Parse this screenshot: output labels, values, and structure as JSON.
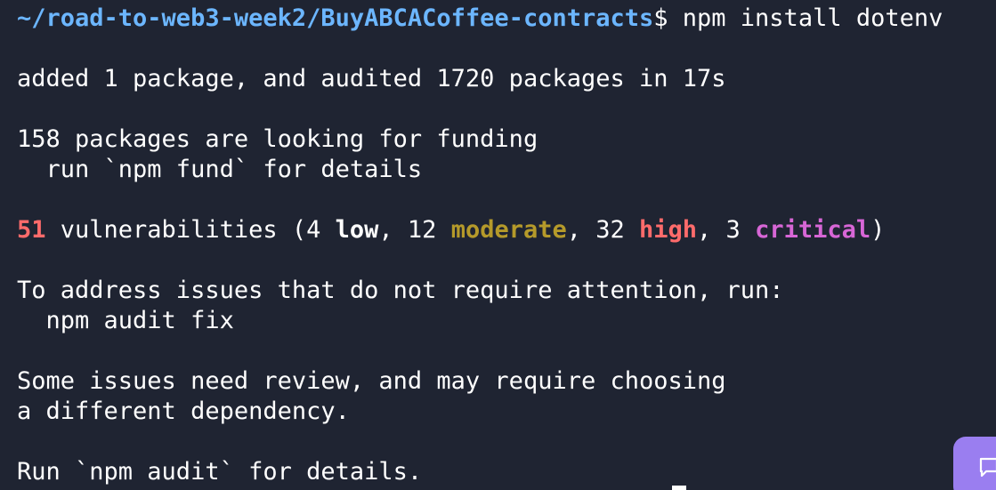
{
  "terminal": {
    "prompt_path": "~/road-to-web3-week2/BuyABCACoffee-contracts",
    "prompt_symbol": "$",
    "command": " npm install dotenv",
    "added_line": "added 1 package, and audited 1720 packages in 17s",
    "funding_line": "158 packages are looking for funding",
    "fund_hint": "  run `npm fund` for details",
    "vuln": {
      "count": "51",
      "text_a": " vulnerabilities (4 ",
      "low": "low",
      "sep1": ", 12 ",
      "moderate": "moderate",
      "sep2": ", 32 ",
      "high": "high",
      "sep3": ", 3 ",
      "critical": "critical",
      "close": ")"
    },
    "address_line": "To address issues that do not require attention, run:",
    "audit_fix": "  npm audit fix",
    "review_line1": "Some issues need review, and may require choosing",
    "review_line2": "a different dependency.",
    "run_audit": "Run `npm audit` for details."
  },
  "colors": {
    "background": "#1f2432",
    "prompt_path": "#6cb6ff",
    "count": "#ff6b6b",
    "moderate": "#b59a2a",
    "high": "#ff6b6b",
    "critical": "#d766d6",
    "chat_button": "#9a7ef0"
  },
  "icons": {
    "chat_button": "chat-bubble-icon"
  }
}
